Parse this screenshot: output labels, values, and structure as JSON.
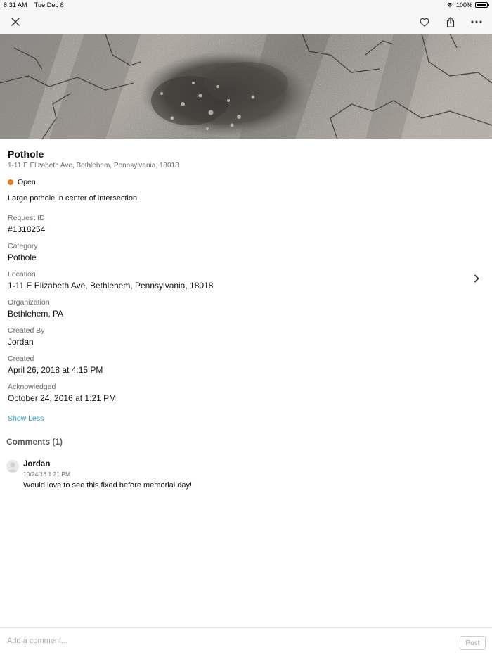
{
  "status_bar": {
    "time": "8:31 AM",
    "date": "Tue Dec 8",
    "battery": "100%",
    "icons": [
      "wifi-icon",
      "battery-icon"
    ]
  },
  "nav": {
    "icons": [
      "close-icon",
      "heart-icon",
      "share-icon",
      "more-icon"
    ]
  },
  "request": {
    "title": "Pothole",
    "address": "1-11 E Elizabeth Ave, Bethlehem, Pennsylvania, 18018",
    "status": "Open",
    "status_color": "#ee7b13",
    "description": "Large pothole in center of intersection."
  },
  "fields": [
    {
      "label": "Request ID",
      "value": "#1318254"
    },
    {
      "label": "Category",
      "value": "Pothole"
    },
    {
      "label": "Location",
      "value": "1-11 E Elizabeth Ave, Bethlehem, Pennsylvania, 18018"
    },
    {
      "label": "Organization",
      "value": "Bethlehem, PA"
    },
    {
      "label": "Created By",
      "value": "Jordan"
    },
    {
      "label": "Created",
      "value": "April 26, 2018 at 4:15 PM"
    },
    {
      "label": "Acknowledged",
      "value": "October 24, 2016 at 1:21 PM"
    }
  ],
  "show_less": "Show Less",
  "comments": {
    "heading": "Comments (1)",
    "items": [
      {
        "author": "Jordan",
        "time": "10/24/16 1:21 PM",
        "text": "Would love to see this fixed before memorial day!"
      }
    ]
  },
  "composer": {
    "placeholder": "Add a comment...",
    "post_label": "Post"
  },
  "colors": {
    "link": "#2c98c6",
    "nav_background": "#f7f7f7"
  }
}
